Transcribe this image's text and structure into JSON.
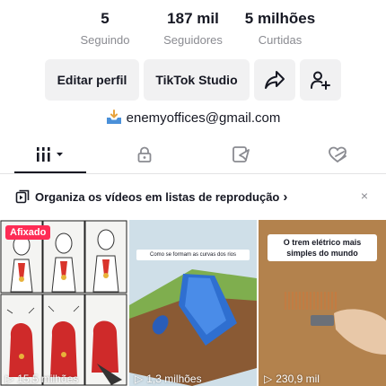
{
  "stats": [
    {
      "value": "5",
      "label": "Seguindo"
    },
    {
      "value": "187 mil",
      "label": "Seguidores"
    },
    {
      "value": "5 milhões",
      "label": "Curtidas"
    }
  ],
  "actions": {
    "edit_profile": "Editar perfil",
    "tiktok_studio": "TikTok Studio"
  },
  "profile": {
    "email": "enemyoffices@gmail.com",
    "email_icon": "inbox-tray-icon"
  },
  "tabs": [
    {
      "name": "videos",
      "icon": "grid-icon",
      "active": true
    },
    {
      "name": "private",
      "icon": "lock-icon"
    },
    {
      "name": "reposts",
      "icon": "repost-icon"
    },
    {
      "name": "liked",
      "icon": "liked-icon"
    }
  ],
  "playlist_banner": {
    "text": "Organiza os vídeos em listas de reprodução",
    "chevron": "›",
    "close": "×"
  },
  "videos": [
    {
      "views": "15,5 milhões",
      "pinned_label": "Afixado"
    },
    {
      "views": "1,3 milhões",
      "caption": "Como se formam as curvas dos rios"
    },
    {
      "views": "230,9 mil",
      "caption": "O trem elétrico mais simples do mundo"
    }
  ],
  "colors": {
    "text": "#161823",
    "muted": "#8a8b91",
    "button_bg": "#f1f1f2",
    "pinned": "#fe2c55"
  }
}
